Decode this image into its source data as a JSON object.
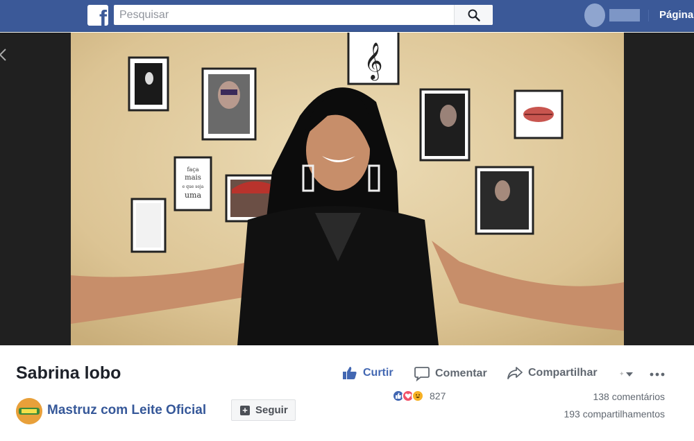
{
  "header": {
    "logo_letter": "f",
    "search_placeholder": "Pesquisar",
    "nav_page": "Página"
  },
  "video": {
    "title": "Sabrina lobo",
    "poster_texts": [
      "faça",
      "mais",
      "e que seja",
      "uma"
    ]
  },
  "page": {
    "name": "Mastruz com Leite Oficial",
    "follow_label": "Seguir"
  },
  "actions": {
    "like": "Curtir",
    "comment": "Comentar",
    "share": "Compartilhar"
  },
  "stats": {
    "reactions_count": "827",
    "comments": "138 comentários",
    "shares": "193 compartilhamentos"
  },
  "colors": {
    "brand": "#3b5998",
    "link": "#365899",
    "like_blue": "#4267b2",
    "love_red": "#f25268",
    "haha_yellow": "#f7b125"
  },
  "icons": {
    "search": "search-icon",
    "like": "thumbs-up-icon",
    "comment": "speech-bubble-icon",
    "share": "share-arrow-icon",
    "more": "ellipsis-icon"
  }
}
